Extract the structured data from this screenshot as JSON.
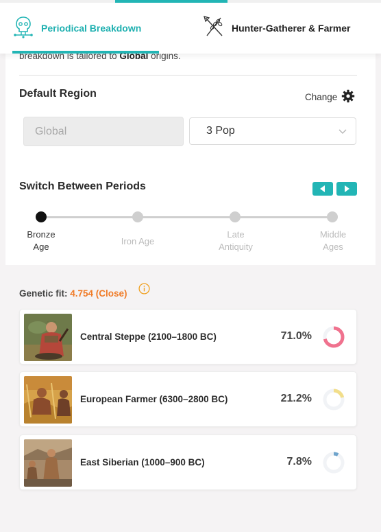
{
  "tabs": [
    {
      "label": "Periodical Breakdown",
      "active": true,
      "icon": "dna-head-icon"
    },
    {
      "label": "Hunter-Gatherer & Farmer",
      "active": false,
      "icon": "spear-wheat-icon"
    }
  ],
  "intro": {
    "prefix": "breakdown is tailored to ",
    "bold": "Global",
    "suffix": " origins."
  },
  "default_region": {
    "title": "Default Region",
    "change_label": "Change",
    "region_value": "Global",
    "pop_value": "3 Pop"
  },
  "periods": {
    "title": "Switch Between Periods",
    "items": [
      {
        "label": "Bronze\nAge",
        "active": true
      },
      {
        "label": "Iron Age",
        "active": false
      },
      {
        "label": "Late\nAntiquity",
        "active": false
      },
      {
        "label": "Middle\nAges",
        "active": false
      }
    ]
  },
  "genetic_fit": {
    "label": "Genetic fit: ",
    "value": "4.754 (Close)"
  },
  "populations": [
    {
      "name": "Central Steppe (2100–1800 BC)",
      "percent_label": "71.0%",
      "percent": 71.0,
      "color": "#f0728e"
    },
    {
      "name": "European Farmer (6300–2800 BC)",
      "percent_label": "21.2%",
      "percent": 21.2,
      "color": "#f2de8a"
    },
    {
      "name": "East Siberian (1000–900 BC)",
      "percent_label": "7.8%",
      "percent": 7.8,
      "color": "#6fa4cc"
    }
  ],
  "colors": {
    "accent": "#22b5b5",
    "fit_value": "#f07b27",
    "info": "#f0a020"
  }
}
